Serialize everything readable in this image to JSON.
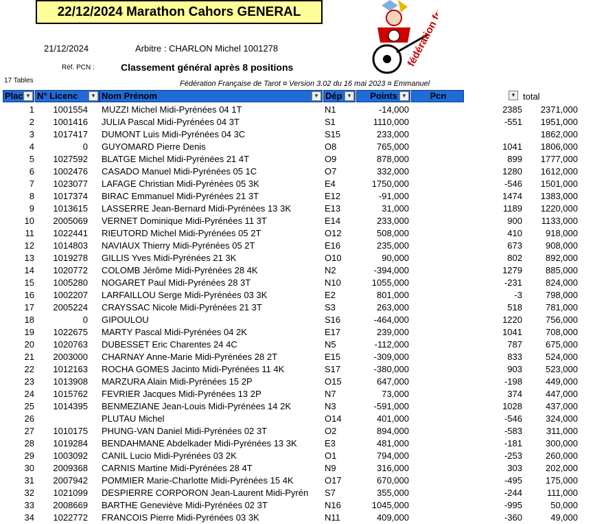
{
  "title": "22/12/2024 Marathon Cahors GENERAL",
  "date": "21/12/2024",
  "arbitre": "Arbitre : CHARLON Michel 1001278",
  "ref_pcn_label": "Réf. PCN :",
  "classement": "Classement général après 8 positions",
  "tables_count": "17 Tables",
  "federation": "Fédération Française de Tarot ¤ Version 3.02 du 16 mai 2023 ¤ Emmanuel",
  "logo_text": "fédération française de TAROT",
  "headers": {
    "place": "Plac",
    "licence": "N° Licenc",
    "nom": "Nom Prénom",
    "dep": "Dép",
    "points": "Points",
    "pcn": "Pcn",
    "total": "total"
  },
  "rows": [
    {
      "place": "1",
      "licence": "1001554",
      "nom": "MUZZI Michel Midi-Pyrénées 04 1T",
      "dep": "N1",
      "points": "-14,000",
      "pcn": "2385",
      "total": "2371,000"
    },
    {
      "place": "2",
      "licence": "1001416",
      "nom": "JULIA Pascal Midi-Pyrénées 04 3T",
      "dep": "S1",
      "points": "1110,000",
      "pcn": "-551",
      "total": "1951,000"
    },
    {
      "place": "3",
      "licence": "1017417",
      "nom": "DUMONT Luis Midi-Pyrénées 04 3C",
      "dep": "S15",
      "points": "233,000",
      "pcn": "",
      "total": "1862,000"
    },
    {
      "place": "4",
      "licence": "0",
      "nom": "GUYOMARD Pierre Denis",
      "dep": "O8",
      "points": "765,000",
      "pcn": "1041",
      "total": "1806,000"
    },
    {
      "place": "5",
      "licence": "1027592",
      "nom": "BLATGE Michel Midi-Pyrénées 21 4T",
      "dep": "O9",
      "points": "878,000",
      "pcn": "899",
      "total": "1777,000"
    },
    {
      "place": "6",
      "licence": "1002476",
      "nom": "CASADO Manuel Midi-Pyrénées 05 1C",
      "dep": "O7",
      "points": "332,000",
      "pcn": "1280",
      "total": "1612,000"
    },
    {
      "place": "7",
      "licence": "1023077",
      "nom": "LAFAGE Christian Midi-Pyrénées 05 3K",
      "dep": "E4",
      "points": "1750,000",
      "pcn": "-546",
      "total": "1501,000"
    },
    {
      "place": "8",
      "licence": "1017374",
      "nom": "BIRAC Emmanuel Midi-Pyrénées 21 3T",
      "dep": "E12",
      "points": "-91,000",
      "pcn": "1474",
      "total": "1383,000"
    },
    {
      "place": "9",
      "licence": "1013615",
      "nom": "LASSERRE Jean-Bernard Midi-Pyrénées 13 3K",
      "dep": "E13",
      "points": "31,000",
      "pcn": "1189",
      "total": "1220,000"
    },
    {
      "place": "10",
      "licence": "2005069",
      "nom": "VERNET Dominique Midi-Pyrénées 11 3T",
      "dep": "E14",
      "points": "233,000",
      "pcn": "900",
      "total": "1133,000"
    },
    {
      "place": "11",
      "licence": "1022441",
      "nom": "RIEUTORD Michel Midi-Pyrénées 05 2T",
      "dep": "O12",
      "points": "508,000",
      "pcn": "410",
      "total": "918,000"
    },
    {
      "place": "12",
      "licence": "1014803",
      "nom": "NAVIAUX Thierry Midi-Pyrénées 05 2T",
      "dep": "E16",
      "points": "235,000",
      "pcn": "673",
      "total": "908,000"
    },
    {
      "place": "13",
      "licence": "1019278",
      "nom": "GILLIS Yves Midi-Pyrénées 21 3K",
      "dep": "O10",
      "points": "90,000",
      "pcn": "802",
      "total": "892,000"
    },
    {
      "place": "14",
      "licence": "1020772",
      "nom": "COLOMB Jérôme Midi-Pyrénées 28 4K",
      "dep": "N2",
      "points": "-394,000",
      "pcn": "1279",
      "total": "885,000"
    },
    {
      "place": "15",
      "licence": "1005280",
      "nom": "NOGARET Paul Midi-Pyrénées 28 3T",
      "dep": "N10",
      "points": "1055,000",
      "pcn": "-231",
      "total": "824,000"
    },
    {
      "place": "16",
      "licence": "1002207",
      "nom": "LARFAILLOU Serge Midi-Pyrénées 03 3K",
      "dep": "E2",
      "points": "801,000",
      "pcn": "-3",
      "total": "798,000"
    },
    {
      "place": "17",
      "licence": "2005224",
      "nom": "CRAYSSAC Nicole Midi-Pyrénées 21 3T",
      "dep": "S3",
      "points": "263,000",
      "pcn": "518",
      "total": "781,000"
    },
    {
      "place": "18",
      "licence": "0",
      "nom": "GIPOULOU",
      "dep": "S16",
      "points": "-464,000",
      "pcn": "1220",
      "total": "756,000"
    },
    {
      "place": "19",
      "licence": "1022675",
      "nom": "MARTY Pascal Midi-Pyrénées 04 2K",
      "dep": "E17",
      "points": "239,000",
      "pcn": "1041",
      "total": "708,000"
    },
    {
      "place": "20",
      "licence": "1020763",
      "nom": "DUBESSET Eric Charentes 24 4C",
      "dep": "N5",
      "points": "-112,000",
      "pcn": "787",
      "total": "675,000"
    },
    {
      "place": "21",
      "licence": "2003000",
      "nom": "CHARNAY Anne-Marie Midi-Pyrénées 28 2T",
      "dep": "E15",
      "points": "-309,000",
      "pcn": "833",
      "total": "524,000"
    },
    {
      "place": "22",
      "licence": "1012163",
      "nom": "ROCHA GOMES Jacinto Midi-Pyrénées 11 4K",
      "dep": "S17",
      "points": "-380,000",
      "pcn": "903",
      "total": "523,000"
    },
    {
      "place": "23",
      "licence": "1013908",
      "nom": "MARZURA Alain Midi-Pyrénées 15 2P",
      "dep": "O15",
      "points": "647,000",
      "pcn": "-198",
      "total": "449,000"
    },
    {
      "place": "24",
      "licence": "1015762",
      "nom": "FEVRIER Jacques Midi-Pyrénées 13 2P",
      "dep": "N7",
      "points": "73,000",
      "pcn": "374",
      "total": "447,000"
    },
    {
      "place": "25",
      "licence": "1014395",
      "nom": "BENMEZIANE Jean-Louis Midi-Pyrénées 14 2K",
      "dep": "N3",
      "points": "-591,000",
      "pcn": "1028",
      "total": "437,000"
    },
    {
      "place": "26",
      "licence": "",
      "nom": "PLUTAU Michel",
      "dep": "O14",
      "points": "401,000",
      "pcn": "-546",
      "total": "324,000"
    },
    {
      "place": "27",
      "licence": "1010175",
      "nom": "PHUNG-VAN Daniel Midi-Pyrénées 02 3T",
      "dep": "O2",
      "points": "894,000",
      "pcn": "-583",
      "total": "311,000"
    },
    {
      "place": "28",
      "licence": "1019284",
      "nom": "BENDAHMANE Abdelkader Midi-Pyrénées 13 3K",
      "dep": "E3",
      "points": "481,000",
      "pcn": "-181",
      "total": "300,000"
    },
    {
      "place": "29",
      "licence": "1003092",
      "nom": "CANIL Lucio Midi-Pyrénées 03 2K",
      "dep": "O1",
      "points": "794,000",
      "pcn": "-253",
      "total": "260,000"
    },
    {
      "place": "30",
      "licence": "2009368",
      "nom": "CARNIS Martine Midi-Pyrénées 28 4T",
      "dep": "N9",
      "points": "316,000",
      "pcn": "303",
      "total": "202,000"
    },
    {
      "place": "31",
      "licence": "2007942",
      "nom": "POMMIER Marie-Charlotte Midi-Pyrénées 15 4K",
      "dep": "O17",
      "points": "670,000",
      "pcn": "-495",
      "total": "175,000"
    },
    {
      "place": "32",
      "licence": "1021099",
      "nom": "DESPIERRE CORPORON Jean-Laurent Midi-Pyrén",
      "dep": "S7",
      "points": "355,000",
      "pcn": "-244",
      "total": "111,000"
    },
    {
      "place": "33",
      "licence": "2008669",
      "nom": "BARTHE Geneviève Midi-Pyrénées 02 3T",
      "dep": "N16",
      "points": "1045,000",
      "pcn": "-995",
      "total": "50,000"
    },
    {
      "place": "34",
      "licence": "1022772",
      "nom": "FRANCOIS Pierre Midi-Pyrénées 03 3K",
      "dep": "N11",
      "points": "409,000",
      "pcn": "-360",
      "total": "49,000"
    }
  ]
}
